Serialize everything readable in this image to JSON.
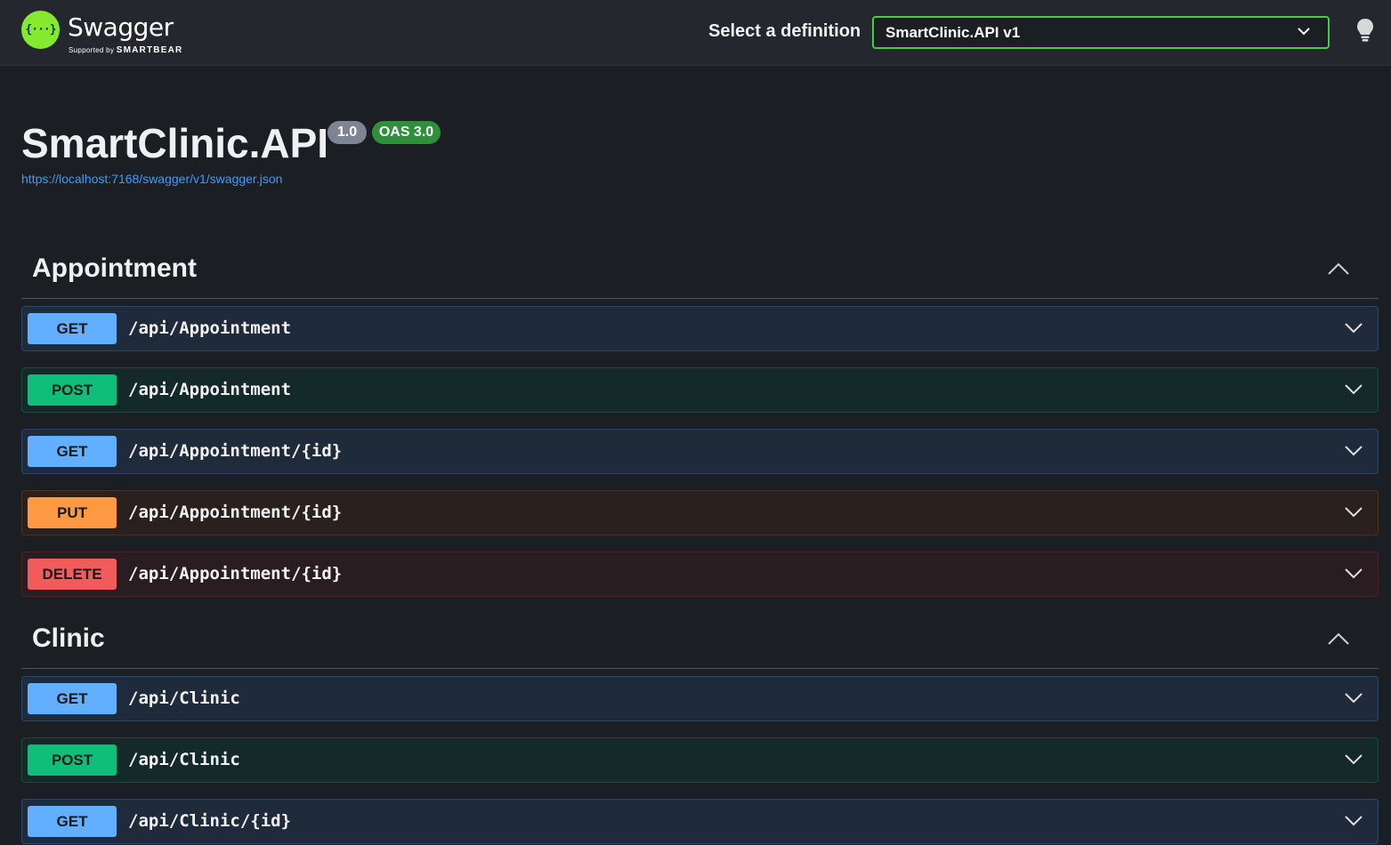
{
  "header": {
    "logo_glyph": "{···}",
    "logo_text": "Swagger",
    "logo_sub_prefix": "Supported by",
    "logo_sub_brand": "SMARTBEAR",
    "definition_label": "Select a definition",
    "definition_selected": "SmartClinic.API v1",
    "accent_color": "#49cc44",
    "icons": [
      "chevron-down-icon",
      "lightbulb-icon"
    ]
  },
  "info": {
    "title": "SmartClinic.API",
    "version_badge": "1.0",
    "oas_badge": "OAS 3.0",
    "spec_url": "https://localhost:7168/swagger/v1/swagger.json"
  },
  "tags": [
    {
      "name": "Appointment",
      "operations": [
        {
          "method": "GET",
          "path": "/api/Appointment"
        },
        {
          "method": "POST",
          "path": "/api/Appointment"
        },
        {
          "method": "GET",
          "path": "/api/Appointment/{id}"
        },
        {
          "method": "PUT",
          "path": "/api/Appointment/{id}"
        },
        {
          "method": "DELETE",
          "path": "/api/Appointment/{id}"
        }
      ]
    },
    {
      "name": "Clinic",
      "operations": [
        {
          "method": "GET",
          "path": "/api/Clinic"
        },
        {
          "method": "POST",
          "path": "/api/Clinic"
        },
        {
          "method": "GET",
          "path": "/api/Clinic/{id}"
        }
      ]
    }
  ],
  "method_colors": {
    "GET": "#61affe",
    "POST": "#0fbe78",
    "PUT": "#fc9942",
    "DELETE": "#f15b5b"
  }
}
